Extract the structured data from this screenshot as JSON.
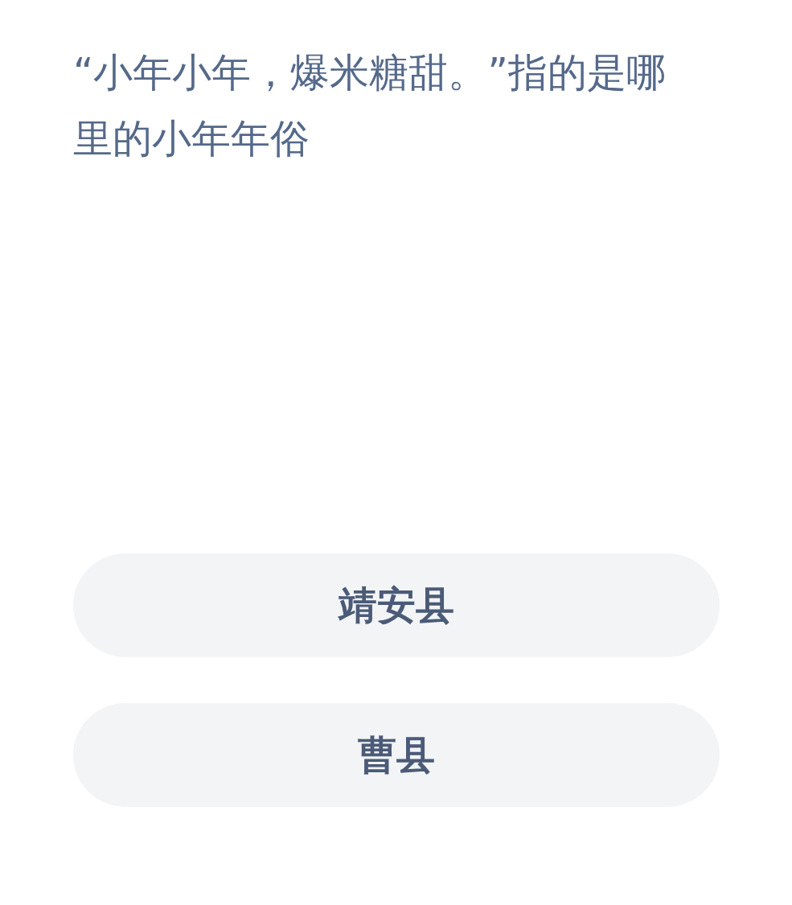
{
  "question": "“小年小年，爆米糖甜。”指的是哪里的小年年俗",
  "options": [
    {
      "label": "靖安县"
    },
    {
      "label": "曹县"
    }
  ]
}
